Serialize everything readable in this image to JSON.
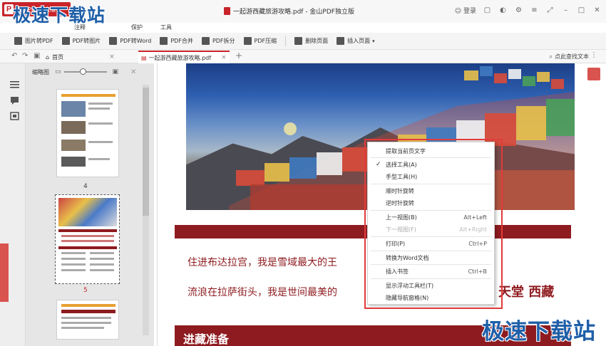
{
  "titlebar": {
    "app_name": "金山PDF独立版",
    "doc_title": "一起游西藏旅游攻略.pdf - 金山PDF独立版",
    "login": "登录"
  },
  "watermark": {
    "text": "极速下载站"
  },
  "menu": {
    "items": [
      "注释",
      "保护",
      "工具"
    ]
  },
  "toolbar": {
    "buttons": [
      "图片转PDF",
      "PDF转图片",
      "PDF转Word",
      "PDF合并",
      "PDF拆分",
      "PDF压缩",
      "删除页面",
      "插入页面"
    ]
  },
  "tabs": {
    "home": "首页",
    "doc": "一起游西藏旅游攻略.pdf",
    "add": "+"
  },
  "find": {
    "label": "点此查找文本"
  },
  "thumbnail_panel": {
    "title": "缩略图",
    "pages": [
      "4",
      "5"
    ]
  },
  "document": {
    "line1": "住进布达拉宫，我是雪域最大的王",
    "line2": "流浪在拉萨街头，我是世间最美的",
    "line2_tail": "天堂 西藏",
    "section": "进藏准备"
  },
  "context_menu": {
    "items": [
      {
        "label": "提取当前页文字",
        "shortcut": ""
      },
      {
        "label": "选择工具(A)",
        "shortcut": "",
        "checked": true
      },
      {
        "label": "手型工具(H)",
        "shortcut": ""
      },
      {
        "label": "顺时针旋转",
        "shortcut": ""
      },
      {
        "label": "逆时针旋转",
        "shortcut": ""
      },
      {
        "label": "上一视图(B)",
        "shortcut": "Alt+Left"
      },
      {
        "label": "下一视图(F)",
        "shortcut": "Alt+Right",
        "disabled": true
      },
      {
        "label": "打印(P)",
        "shortcut": "Ctrl+P"
      },
      {
        "label": "转换为Word文档",
        "shortcut": ""
      },
      {
        "label": "插入书签",
        "shortcut": "Ctrl+B"
      },
      {
        "label": "显示浮动工具栏(T)",
        "shortcut": ""
      },
      {
        "label": "隐藏导航窗格(N)",
        "shortcut": ""
      }
    ]
  },
  "colors": {
    "accent": "#c8242a",
    "doc_red": "#8e1b1f",
    "watermark": "#1f5fa8"
  }
}
